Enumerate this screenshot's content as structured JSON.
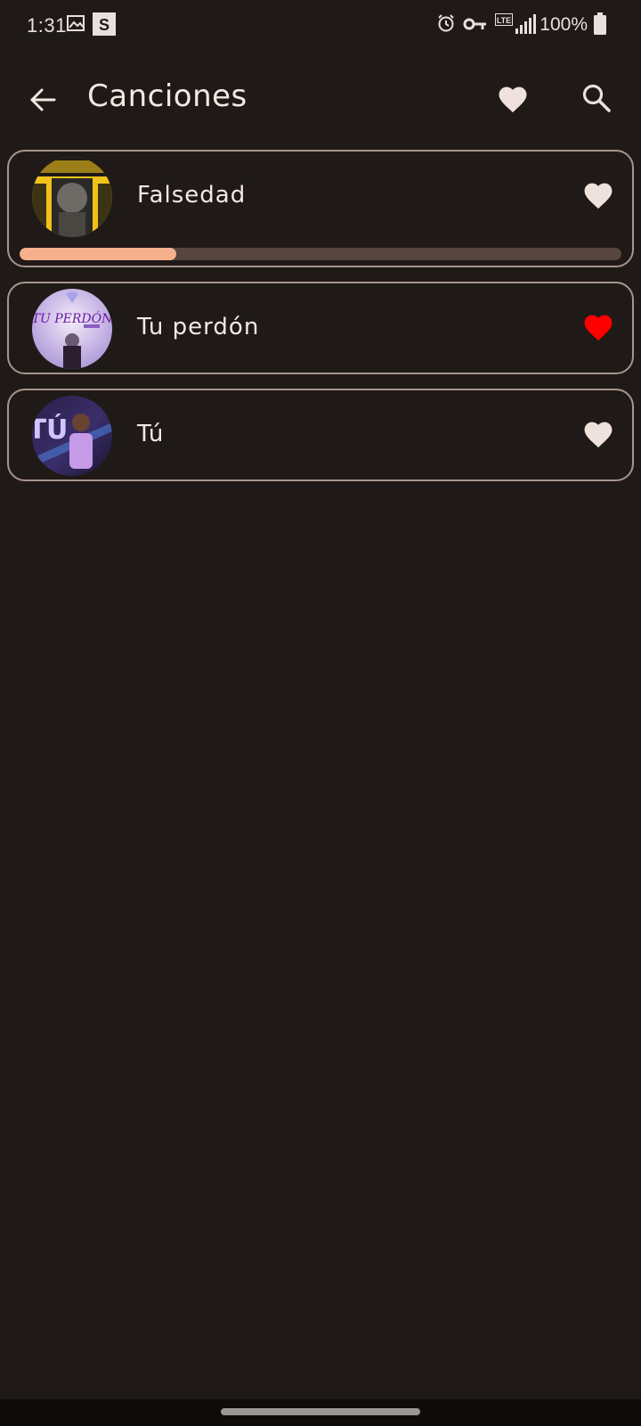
{
  "status_bar": {
    "time": "1:31",
    "battery": "100%",
    "network": "LTE",
    "icons": [
      "image-icon",
      "s-app-icon",
      "alarm-icon",
      "vpn-key-icon",
      "lte-icon",
      "signal-icon",
      "battery-icon"
    ]
  },
  "app_bar": {
    "title": "Canciones",
    "back_icon": "arrow-back-icon",
    "favorites_icon": "heart-icon",
    "search_icon": "search-icon"
  },
  "songs": [
    {
      "title": "Falsedad",
      "favorite": false,
      "playing": true,
      "progress": 0.26,
      "cover": "cover-falsedad"
    },
    {
      "title": "Tu perdón",
      "favorite": true,
      "playing": false,
      "cover": "cover-tu-perdon"
    },
    {
      "title": "Tú",
      "favorite": false,
      "playing": false,
      "cover": "cover-tu"
    }
  ],
  "colors": {
    "background": "#1f1a17",
    "card_border": "#a8948d",
    "heart_off": "#efe2dd",
    "heart_on": "#ff0000",
    "progress_fill": "#f7b08c",
    "progress_track": "#574640",
    "text": "#f3e9e4"
  }
}
